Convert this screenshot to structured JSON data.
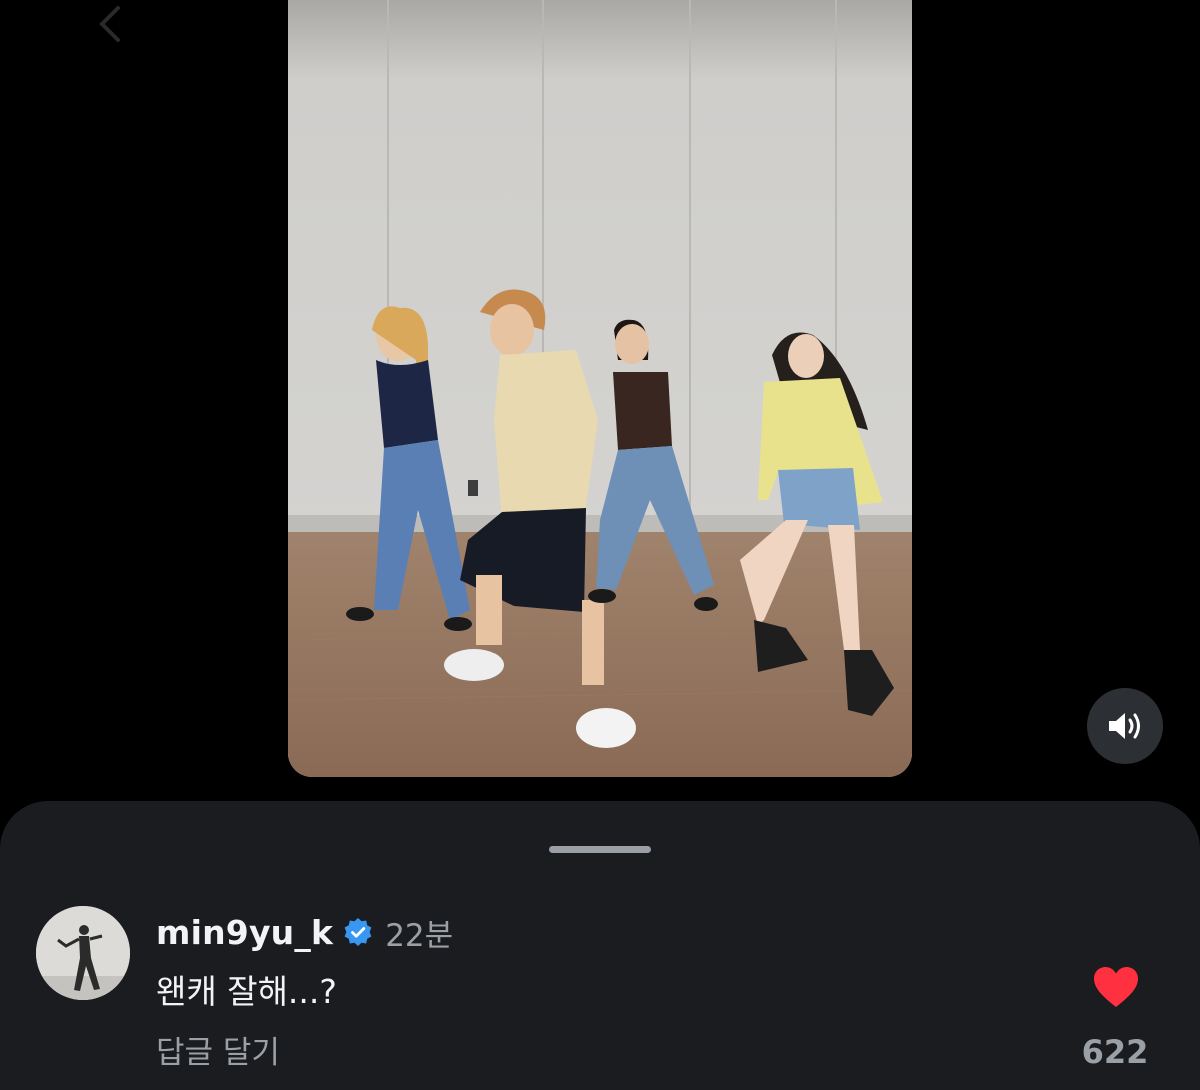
{
  "comment": {
    "username": "min9yu_k",
    "verified": true,
    "timestamp": "22분",
    "text": "왠캐 잘해...?",
    "reply_label": "답글 달기",
    "like_count": "622",
    "liked": true
  },
  "icons": {
    "back": "chevron-left-icon",
    "sound": "speaker-icon",
    "verified": "verified-badge-icon",
    "like": "heart-icon"
  },
  "colors": {
    "like_red": "#ff3040",
    "verified_blue": "#3897f0",
    "sheet_bg": "#1a1c20"
  }
}
